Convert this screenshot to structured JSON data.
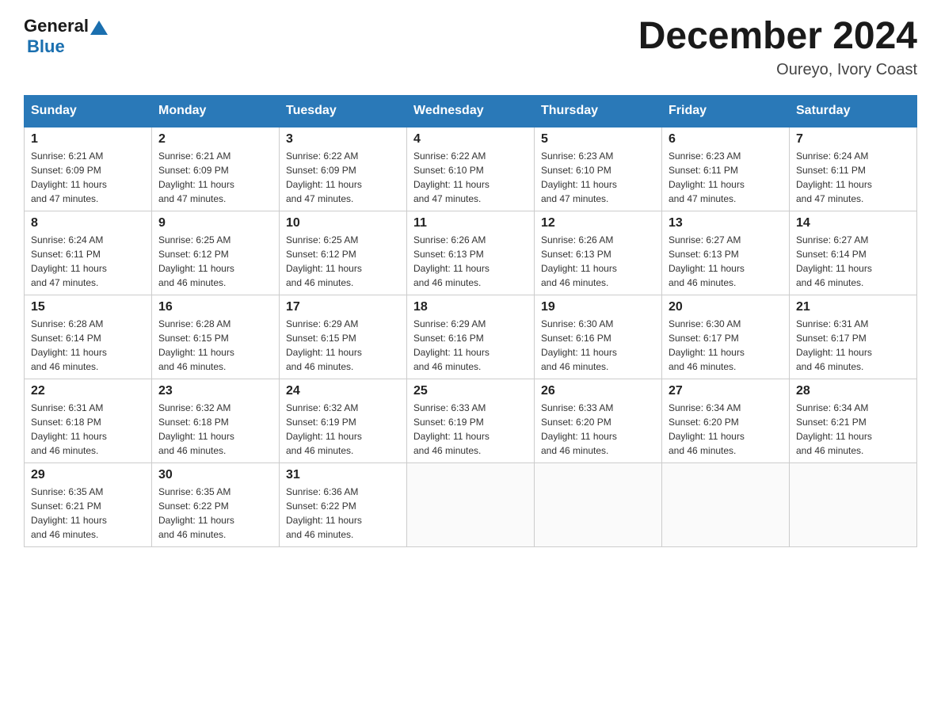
{
  "header": {
    "logo": {
      "general": "General",
      "blue": "Blue"
    },
    "title": "December 2024",
    "location": "Oureyo, Ivory Coast"
  },
  "weekdays": [
    "Sunday",
    "Monday",
    "Tuesday",
    "Wednesday",
    "Thursday",
    "Friday",
    "Saturday"
  ],
  "weeks": [
    [
      {
        "day": "1",
        "sunrise": "6:21 AM",
        "sunset": "6:09 PM",
        "daylight": "11 hours and 47 minutes."
      },
      {
        "day": "2",
        "sunrise": "6:21 AM",
        "sunset": "6:09 PM",
        "daylight": "11 hours and 47 minutes."
      },
      {
        "day": "3",
        "sunrise": "6:22 AM",
        "sunset": "6:09 PM",
        "daylight": "11 hours and 47 minutes."
      },
      {
        "day": "4",
        "sunrise": "6:22 AM",
        "sunset": "6:10 PM",
        "daylight": "11 hours and 47 minutes."
      },
      {
        "day": "5",
        "sunrise": "6:23 AM",
        "sunset": "6:10 PM",
        "daylight": "11 hours and 47 minutes."
      },
      {
        "day": "6",
        "sunrise": "6:23 AM",
        "sunset": "6:11 PM",
        "daylight": "11 hours and 47 minutes."
      },
      {
        "day": "7",
        "sunrise": "6:24 AM",
        "sunset": "6:11 PM",
        "daylight": "11 hours and 47 minutes."
      }
    ],
    [
      {
        "day": "8",
        "sunrise": "6:24 AM",
        "sunset": "6:11 PM",
        "daylight": "11 hours and 47 minutes."
      },
      {
        "day": "9",
        "sunrise": "6:25 AM",
        "sunset": "6:12 PM",
        "daylight": "11 hours and 46 minutes."
      },
      {
        "day": "10",
        "sunrise": "6:25 AM",
        "sunset": "6:12 PM",
        "daylight": "11 hours and 46 minutes."
      },
      {
        "day": "11",
        "sunrise": "6:26 AM",
        "sunset": "6:13 PM",
        "daylight": "11 hours and 46 minutes."
      },
      {
        "day": "12",
        "sunrise": "6:26 AM",
        "sunset": "6:13 PM",
        "daylight": "11 hours and 46 minutes."
      },
      {
        "day": "13",
        "sunrise": "6:27 AM",
        "sunset": "6:13 PM",
        "daylight": "11 hours and 46 minutes."
      },
      {
        "day": "14",
        "sunrise": "6:27 AM",
        "sunset": "6:14 PM",
        "daylight": "11 hours and 46 minutes."
      }
    ],
    [
      {
        "day": "15",
        "sunrise": "6:28 AM",
        "sunset": "6:14 PM",
        "daylight": "11 hours and 46 minutes."
      },
      {
        "day": "16",
        "sunrise": "6:28 AM",
        "sunset": "6:15 PM",
        "daylight": "11 hours and 46 minutes."
      },
      {
        "day": "17",
        "sunrise": "6:29 AM",
        "sunset": "6:15 PM",
        "daylight": "11 hours and 46 minutes."
      },
      {
        "day": "18",
        "sunrise": "6:29 AM",
        "sunset": "6:16 PM",
        "daylight": "11 hours and 46 minutes."
      },
      {
        "day": "19",
        "sunrise": "6:30 AM",
        "sunset": "6:16 PM",
        "daylight": "11 hours and 46 minutes."
      },
      {
        "day": "20",
        "sunrise": "6:30 AM",
        "sunset": "6:17 PM",
        "daylight": "11 hours and 46 minutes."
      },
      {
        "day": "21",
        "sunrise": "6:31 AM",
        "sunset": "6:17 PM",
        "daylight": "11 hours and 46 minutes."
      }
    ],
    [
      {
        "day": "22",
        "sunrise": "6:31 AM",
        "sunset": "6:18 PM",
        "daylight": "11 hours and 46 minutes."
      },
      {
        "day": "23",
        "sunrise": "6:32 AM",
        "sunset": "6:18 PM",
        "daylight": "11 hours and 46 minutes."
      },
      {
        "day": "24",
        "sunrise": "6:32 AM",
        "sunset": "6:19 PM",
        "daylight": "11 hours and 46 minutes."
      },
      {
        "day": "25",
        "sunrise": "6:33 AM",
        "sunset": "6:19 PM",
        "daylight": "11 hours and 46 minutes."
      },
      {
        "day": "26",
        "sunrise": "6:33 AM",
        "sunset": "6:20 PM",
        "daylight": "11 hours and 46 minutes."
      },
      {
        "day": "27",
        "sunrise": "6:34 AM",
        "sunset": "6:20 PM",
        "daylight": "11 hours and 46 minutes."
      },
      {
        "day": "28",
        "sunrise": "6:34 AM",
        "sunset": "6:21 PM",
        "daylight": "11 hours and 46 minutes."
      }
    ],
    [
      {
        "day": "29",
        "sunrise": "6:35 AM",
        "sunset": "6:21 PM",
        "daylight": "11 hours and 46 minutes."
      },
      {
        "day": "30",
        "sunrise": "6:35 AM",
        "sunset": "6:22 PM",
        "daylight": "11 hours and 46 minutes."
      },
      {
        "day": "31",
        "sunrise": "6:36 AM",
        "sunset": "6:22 PM",
        "daylight": "11 hours and 46 minutes."
      },
      null,
      null,
      null,
      null
    ]
  ]
}
